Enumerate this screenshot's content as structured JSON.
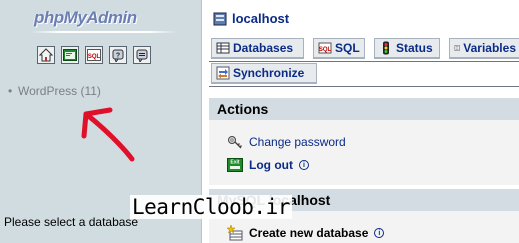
{
  "nav": {
    "logo_text": "phpMyAdmin",
    "icons": [
      "home-icon",
      "query-window-icon",
      "sql-icon",
      "documentation-icon",
      "info-icon"
    ],
    "databases": [
      {
        "label": "WordPress (11)"
      }
    ],
    "select_database_text": "Please select a database"
  },
  "main": {
    "server_title": "localhost",
    "tabs": [
      {
        "label": "Databases",
        "icon": "databases-icon"
      },
      {
        "label": "SQL",
        "icon": "sql-icon"
      },
      {
        "label": "Status",
        "icon": "status-icon"
      },
      {
        "label": "Variables",
        "icon": "variables-icon"
      }
    ],
    "tab_row2": {
      "label": "Synchronize",
      "icon": "synchronize-icon"
    },
    "actions": {
      "title": "Actions",
      "change_password": "Change password",
      "log_out": "Log out"
    },
    "mysql": {
      "title": "MySQL localhost",
      "create_db": "Create new database"
    }
  },
  "watermark": "LearnCloob.ir",
  "colors": {
    "nav_bg": "#d0dce0",
    "link": "#0a2b86",
    "panel_head": "#d2dce2",
    "arrow": "#e0102a"
  }
}
